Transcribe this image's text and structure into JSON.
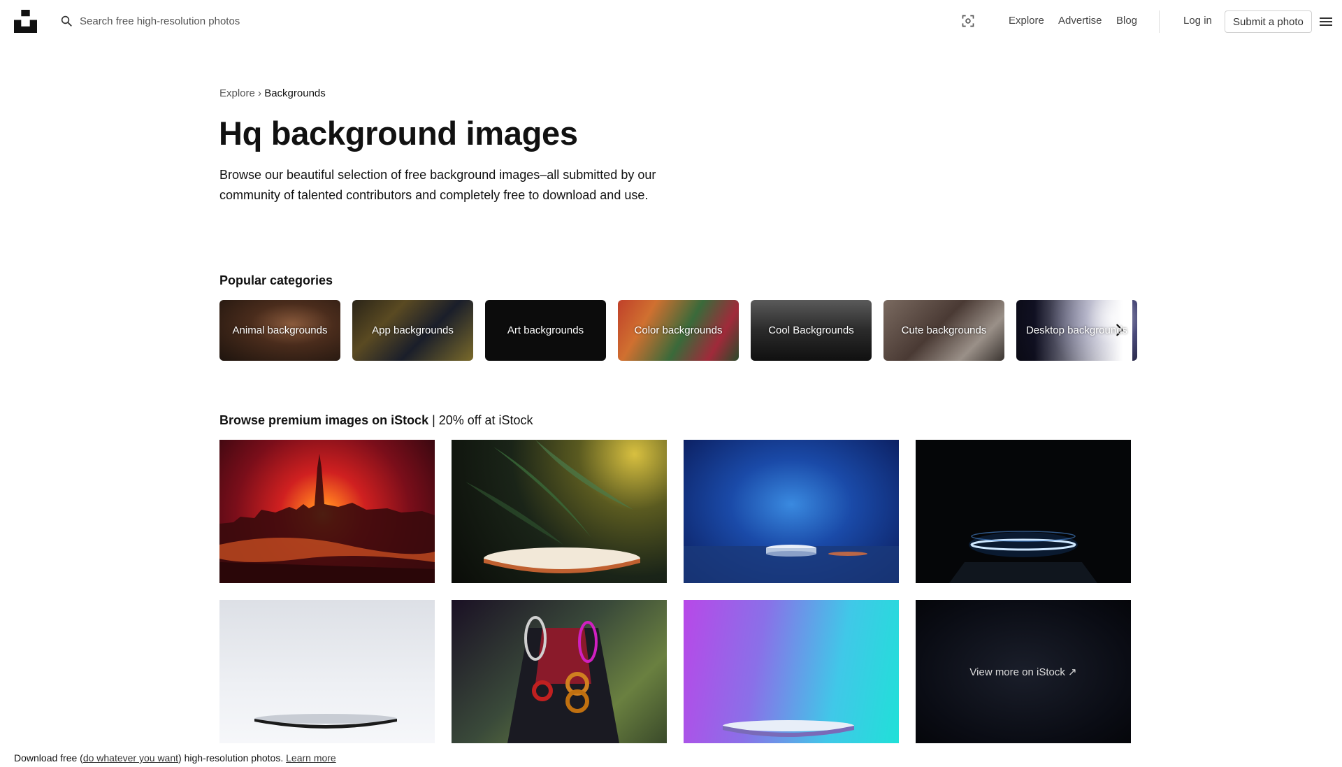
{
  "header": {
    "search_placeholder": "Search free high-resolution photos",
    "nav": [
      "Explore",
      "Advertise",
      "Blog"
    ],
    "login": "Log in",
    "submit": "Submit a photo"
  },
  "breadcrumb": {
    "parent": "Explore",
    "separator": "›",
    "current": "Backgrounds"
  },
  "hero": {
    "title": "Hq background images",
    "description": "Browse our beautiful selection of free background images–all submitted by our community of talented contributors and completely free to download and use."
  },
  "categories": {
    "title": "Popular categories",
    "items": [
      "Animal backgrounds",
      "App backgrounds",
      "Art backgrounds",
      "Color backgrounds",
      "Cool Backgrounds",
      "Cute backgrounds",
      "Desktop backgrounds"
    ]
  },
  "istock": {
    "title_bold": "Browse premium images on iStock",
    "title_rest": " | 20% off at iStock",
    "view_more": "View more on iStock ↗"
  },
  "footer": {
    "prefix": "Download free (",
    "link": "do whatever you want",
    "suffix": ") high-resolution photos.",
    "learn_more": "Learn more"
  },
  "colors": {
    "text": "#111111",
    "muted": "#555555",
    "border": "#d1d1d1"
  }
}
